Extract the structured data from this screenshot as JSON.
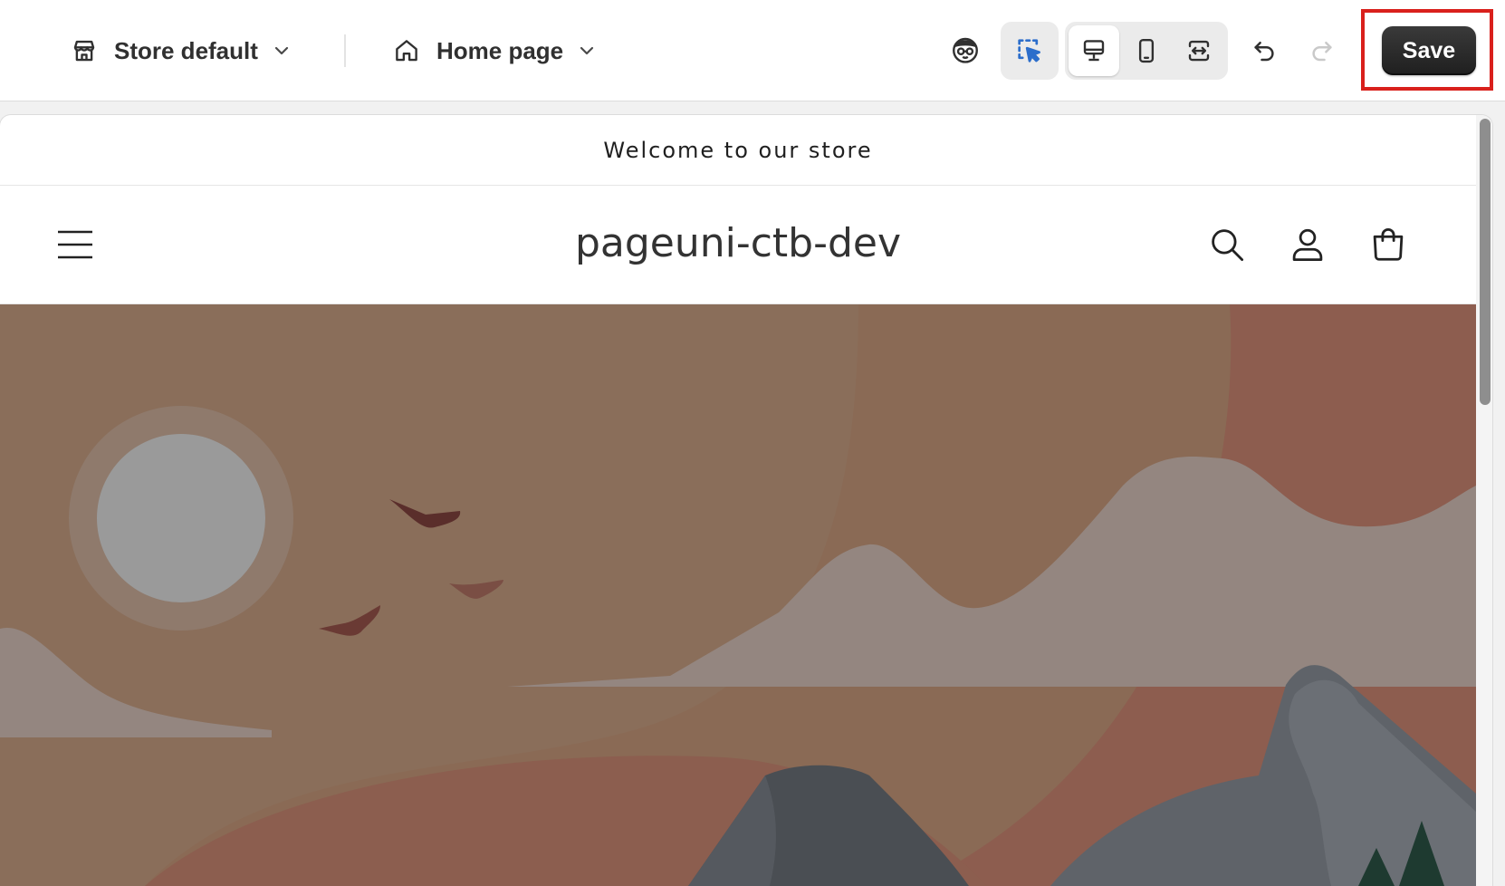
{
  "toolbar": {
    "store_selector": {
      "label": "Store default",
      "icon": "store-icon"
    },
    "page_selector": {
      "label": "Home page",
      "icon": "home-icon"
    },
    "tools": {
      "ai_assistant_icon": "ai-avatar-icon",
      "inspector_icon": "select-cursor-icon",
      "viewports": [
        "desktop-icon",
        "mobile-icon",
        "fullwidth-icon"
      ],
      "active_viewport": "desktop",
      "undo_icon": "undo-icon",
      "redo_icon": "redo-icon"
    },
    "save_label": "Save",
    "highlight_color": "#d9201c"
  },
  "preview": {
    "announcement": "Welcome to our store",
    "store_name": "pageuni-ctb-dev",
    "header_icons": [
      "menu-icon",
      "search-icon",
      "account-icon",
      "cart-icon"
    ],
    "hero": {
      "illustration": "landscape-illustration",
      "colors": {
        "sky": "#8a6e5a",
        "sun": "#9a9a9a",
        "sun_halo": "#8f7a6c",
        "mountain": "#5c6066",
        "cloud": "#948680",
        "hill": "#8a5c4e"
      }
    }
  }
}
